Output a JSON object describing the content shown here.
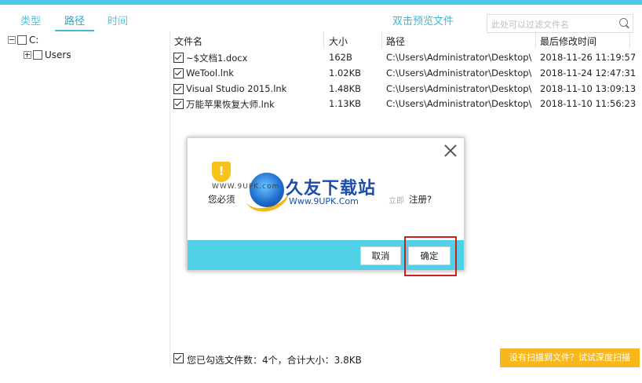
{
  "tabs": [
    {
      "label": "类型",
      "active": false
    },
    {
      "label": "路径",
      "active": true
    },
    {
      "label": "时间",
      "active": false
    }
  ],
  "preview_link": "双击预览文件",
  "search": {
    "placeholder": "此处可以过滤文件名"
  },
  "tree": {
    "drive": "C:",
    "child": "Users"
  },
  "columns": [
    "文件名",
    "大小",
    "路径",
    "最后修改时间"
  ],
  "files": [
    {
      "name": "~$文档1.docx",
      "size": "162B",
      "path": "C:\\Users\\Administrator\\Desktop\\",
      "modified": "2018-11-26 11:19:57",
      "checked": true
    },
    {
      "name": "WeTool.lnk",
      "size": "1.02KB",
      "path": "C:\\Users\\Administrator\\Desktop\\",
      "modified": "2018-11-24 12:47:31",
      "checked": true
    },
    {
      "name": "Visual Studio 2015.lnk",
      "size": "1.48KB",
      "path": "C:\\Users\\Administrator\\Desktop\\",
      "modified": "2018-11-10 13:09:13",
      "checked": true
    },
    {
      "name": "万能苹果恢复大师.lnk",
      "size": "1.13KB",
      "path": "C:\\Users\\Administrator\\Desktop\\",
      "modified": "2018-11-10 11:56:23",
      "checked": true
    }
  ],
  "status": {
    "summary": "您已勾选文件数：4个，合计大小：3.8KB",
    "deep_scan_label": "没有扫描到文件？试试深度扫描"
  },
  "dialog": {
    "message_left": "您必须",
    "message_right": "注册?",
    "warning_glyph": "!",
    "cancel_label": "取消",
    "ok_label": "确定"
  },
  "watermark": {
    "site_left": "WWW.9UPK.com",
    "title": "久友下载站",
    "site": "Www.9UPK.Com",
    "faint": "立即"
  },
  "colors": {
    "accent": "#4fc9e6",
    "dialog_footer": "#4fd0e7",
    "deep_scan": "#f8b81c",
    "highlight": "#cc1f1f"
  }
}
